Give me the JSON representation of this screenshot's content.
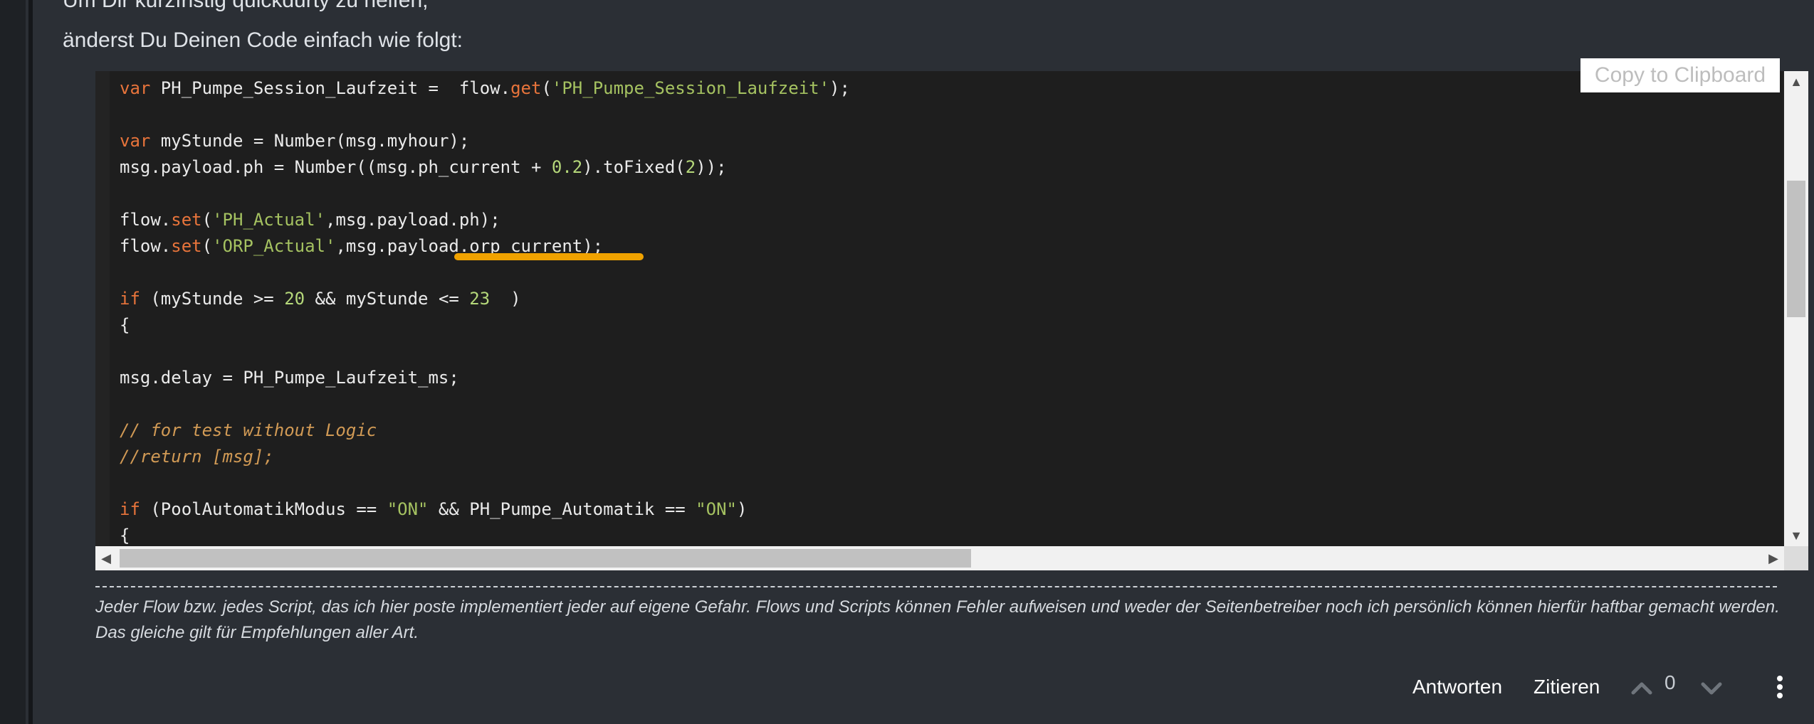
{
  "post": {
    "intro_line_1": "Um Dir kurzfristig quickdurty zu helfen,",
    "intro_line_2": "änderst Du Deinen Code einfach wie folgt:",
    "copy_label": "Copy to Clipboard",
    "signature": "Jeder Flow bzw. jedes Script, das ich hier poste implementiert jeder auf eigene Gefahr. Flows und Scripts können Fehler aufweisen und weder der Seitenbetreiber noch ich persönlich können hierfür haftbar gemacht werden. Das gleiche gilt für Empfehlungen aller Art."
  },
  "code": {
    "l1": {
      "kw": "var",
      "a": " PH_Pumpe_Session_Laufzeit =  flow.",
      "fn": "get",
      "b": "(",
      "s": "'PH_Pumpe_Session_Laufzeit'",
      "c": ");"
    },
    "l3": {
      "kw": "var",
      "a": " myStunde = Number(msg.myhour);"
    },
    "l4": {
      "a": "msg.payload.ph = Number((msg.ph_current + ",
      "n": "0.2",
      "b": ").toFixed(",
      "n2": "2",
      "c": "));"
    },
    "l6": {
      "a": "flow.",
      "fn": "set",
      "b": "(",
      "s": "'PH_Actual'",
      "c": ",msg.payload.ph);"
    },
    "l7": {
      "a": "flow.",
      "fn": "set",
      "b": "(",
      "s": "'ORP_Actual'",
      "c": ",msg.payload.orp_current);"
    },
    "l9": {
      "kw": "if",
      "a": " (myStunde >= ",
      "n": "20",
      "b": " && myStunde <= ",
      "n2": "23",
      "c": "  )"
    },
    "l10": "{",
    "l12": "msg.delay = PH_Pumpe_Laufzeit_ms;",
    "l14": "// for test without Logic",
    "l15": "//return [msg];",
    "l17": {
      "kw": "if",
      "a": " (PoolAutomatikModus == ",
      "s": "\"ON\"",
      "b": " && PH_Pumpe_Automatik == ",
      "s2": "\"ON\"",
      "c": ")"
    },
    "l18": "{"
  },
  "actions": {
    "reply": "Antworten",
    "quote": "Zitieren",
    "votes": "0"
  },
  "icons": {
    "upvote": "chevron-up-icon",
    "downvote": "chevron-down-icon",
    "more": "vertical-dots-icon"
  },
  "colors": {
    "keyword": "#e8743b",
    "string": "#a5c261",
    "comment": "#d19a55",
    "highlight": "#f0a200"
  }
}
